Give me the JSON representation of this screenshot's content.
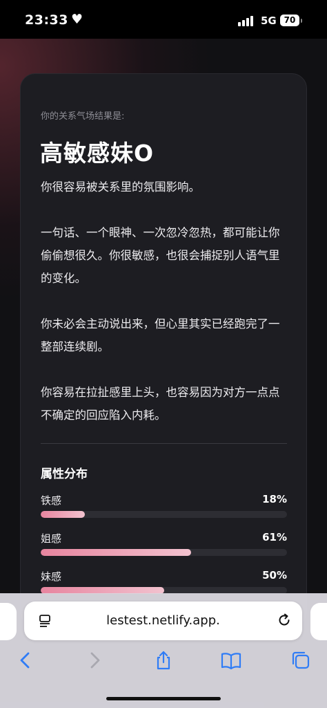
{
  "status": {
    "time": "23:33",
    "network": "5G",
    "battery": "70"
  },
  "card": {
    "intro": "你的关系气场结果是:",
    "title": "高敏感妹O",
    "paragraphs": [
      "你很容易被关系里的氛围影响。",
      "一句话、一个眼神、一次忽冷忽热，都可能让你偷偷想很久。你很敏感，也很会捕捉别人语气里的变化。",
      "你未必会主动说出来，但心里其实已经跑完了一整部连续剧。",
      "你容易在拉扯感里上头，也容易因为对方一点点不确定的回应陷入内耗。"
    ],
    "attributes_title": "属性分布",
    "attributes": [
      {
        "label": "铁感",
        "percent_text": "18%",
        "value": 18
      },
      {
        "label": "姐感",
        "percent_text": "61%",
        "value": 61
      },
      {
        "label": "妹感",
        "percent_text": "50%",
        "value": 50
      }
    ]
  },
  "browser": {
    "url": "lestest.netlify.app.",
    "icons": [
      "reader-icon",
      "reload-icon",
      "back-icon",
      "forward-icon",
      "share-icon",
      "bookmarks-icon",
      "tabs-icon"
    ]
  },
  "colors": {
    "accent_fill_start": "#e7859f",
    "accent_fill_end": "#f2c2cf",
    "card_bg": "#1d1d22",
    "ios_blue": "#2f7cf6"
  }
}
